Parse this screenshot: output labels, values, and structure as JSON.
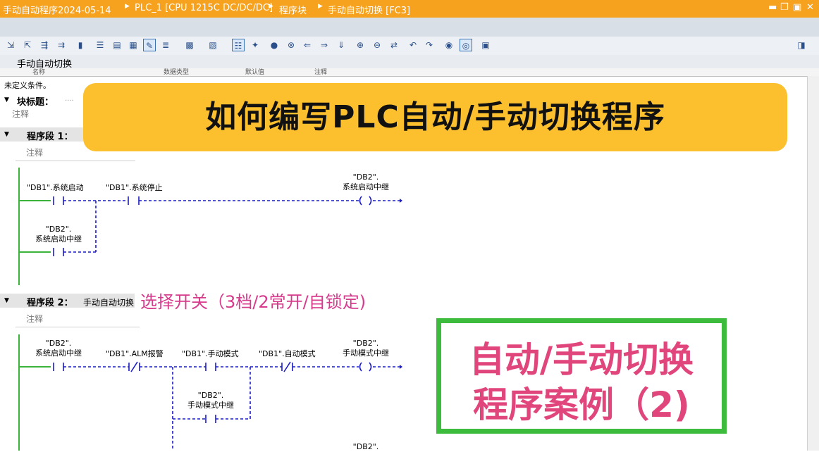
{
  "breadcrumb": [
    "手动自动程序2024-05-14",
    "PLC_1 [CPU 1215C DC/DC/DC]",
    "程序块",
    "手动自动切换 [FC3]"
  ],
  "window_controls": [
    "▬",
    "❐",
    "▣",
    "✕"
  ],
  "toolbar_icons": [
    "insert-network-icon",
    "delete-network-icon",
    "insert-row-icon",
    "add-row-icon",
    "absolute-operand-icon",
    "network-overview-icon",
    "all-networks-icon",
    "open-networks-icon",
    "comments-icon",
    "favorites-icon",
    "symbol-info-icon",
    "operand-display-icon",
    "instruction-list-icon",
    "monitor-icon",
    "set-breakpoint-icon",
    "clear-breakpoint-icon",
    "go-previous-icon",
    "go-next-icon",
    "step-over-icon",
    "expand-icon",
    "collapse-icon",
    "navigate-icon",
    "refresh-icon",
    "undo-icon",
    "redo-icon",
    "simulate-icon",
    "monitoring-on-icon",
    "lock-icon",
    "right-panel-icon"
  ],
  "block_name": "手动自动切换",
  "interface_headers": [
    "名称",
    "数据类型",
    "默认值",
    "注释"
  ],
  "undefined_conditions": "未定义条件。",
  "block_title": {
    "label": "块标题：",
    "dots": "....",
    "comment": "注释"
  },
  "network1": {
    "label": "程序段 1：",
    "comment": "注释"
  },
  "network2": {
    "label": "程序段 2：",
    "title": "手动自动切换",
    "comment": "注释"
  },
  "banner": "如何编写PLC自动/手动切换程序",
  "pink_note": "选择开关（3档/2常开/自锁定)",
  "green_box": {
    "line1": "自动/手动切换",
    "line2": "程序案例（2)"
  },
  "contacts": {
    "n1_start": "\"DB1\".系统启动",
    "n1_stop": "\"DB1\".系统停止",
    "n1_relay_parallel_a": "\"DB2\".",
    "n1_relay_parallel_b": "系统启动中继",
    "n1_coil_a": "\"DB2\".",
    "n1_coil_b": "系统启动中继",
    "n2_relay_a": "\"DB2\".",
    "n2_relay_b": "系统启动中继",
    "n2_alm": "\"DB1\".ALM报警",
    "n2_manual": "\"DB1\".手动模式",
    "n2_auto": "\"DB1\".自动模式",
    "n2_coil_a": "\"DB2\".",
    "n2_coil_b": "手动模式中继",
    "n2_parallel_a": "\"DB2\".",
    "n2_parallel_b": "手动模式中继",
    "n2_bottom_a": "\"DB2\"."
  },
  "colors": {
    "titlebar": "#f6a21e",
    "banner": "#fcc02e",
    "pink": "#d63b8c",
    "green_border": "#3dbb3d",
    "green_text": "#e0457b",
    "rail": "#3cb43c",
    "wire": "#1a1ac8"
  }
}
